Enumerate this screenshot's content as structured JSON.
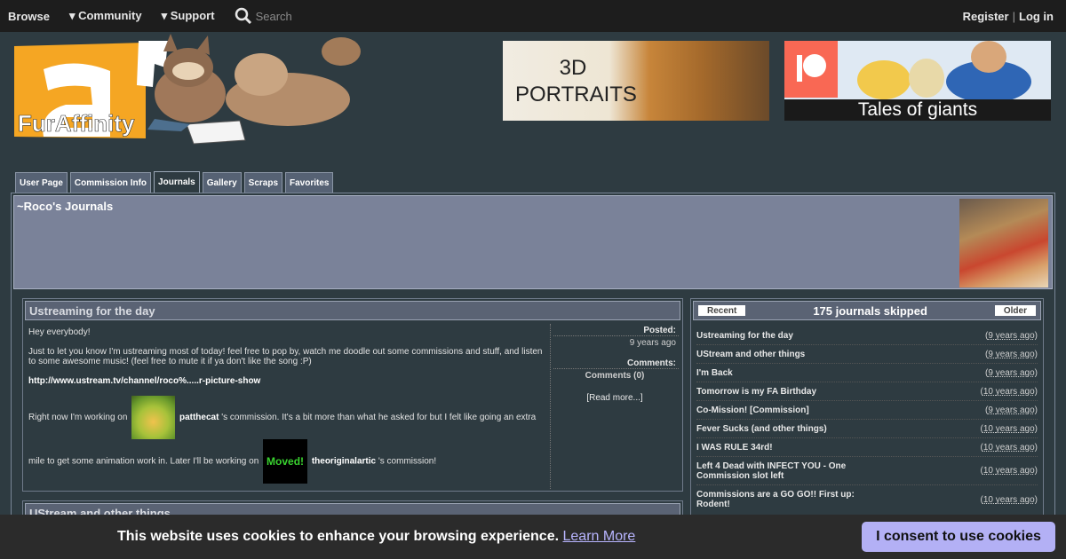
{
  "topnav": {
    "browse": "Browse",
    "community": "▾ Community",
    "support": "▾ Support",
    "search_placeholder": "Search",
    "register": "Register",
    "separator": "|",
    "login": "Log in"
  },
  "logo": {
    "text": "FurAffinity"
  },
  "ads": {
    "ad1_text": "3D PORTRAITS",
    "ad2_text": "Tales of giants"
  },
  "tabs": [
    "User Page",
    "Commission Info",
    "Journals",
    "Gallery",
    "Scraps",
    "Favorites"
  ],
  "active_tab": "Journals",
  "user": {
    "journals_title": "~Roco's Journals"
  },
  "journal": {
    "title": "Ustreaming for the day",
    "p1": "Hey everybody!",
    "p2": "Just to let you know I'm ustreaming most of today! feel free to pop by, watch me doodle out some commissions and stuff, and listen to some awesome music! (feel free to mute it if ya don't like the song :P)",
    "link": "http://www.ustream.tv/channel/roco%.....r-picture-show",
    "p3_before": "Right now I'm working on",
    "user1": "patthecat",
    "p3_after": "'s commission. It's a bit more than what he asked for but I felt like going an extra",
    "p4_before": "mile to get some animation work in. Later I'll be working on",
    "user2_thumb": "Moved!",
    "user2": "theoriginalartic",
    "p4_after": "'s commission!",
    "posted_label": "Posted:",
    "posted_value": "9 years ago",
    "comments_label": "Comments:",
    "comments_value": "Comments (0)",
    "read_more": "[Read more...]"
  },
  "journal2": {
    "title": "UStream and other things"
  },
  "sidebar": {
    "recent": "Recent",
    "skipped": "175 journals skipped",
    "older": "Older",
    "items": [
      {
        "title": "Ustreaming for the day",
        "date": "9 years ago"
      },
      {
        "title": "UStream and other things",
        "date": "9 years ago"
      },
      {
        "title": "I'm Back",
        "date": "9 years ago"
      },
      {
        "title": "Tomorrow is my FA Birthday",
        "date": "10 years ago"
      },
      {
        "title": "Co-Mission! [Commission]",
        "date": "9 years ago"
      },
      {
        "title": "Fever Sucks (and other things)",
        "date": "10 years ago"
      },
      {
        "title": "I WAS RULE 34rd!",
        "date": "10 years ago"
      },
      {
        "title": "Left 4 Dead with INFECT YOU - One Commission slot left",
        "date": "10 years ago"
      },
      {
        "title": "Commissions are a GO GO!! First up: Rodent!",
        "date": "10 years ago"
      }
    ]
  },
  "cookie": {
    "message": "This website uses cookies to enhance your browsing experience.",
    "learn_more": "Learn More",
    "consent": "I consent to use cookies"
  },
  "colors": {
    "background": "#2e3b41",
    "topbar": "#1d1d1d",
    "header_panel": "#7a8299",
    "tab": "#566274",
    "cookie_button": "#b3b0f5"
  }
}
